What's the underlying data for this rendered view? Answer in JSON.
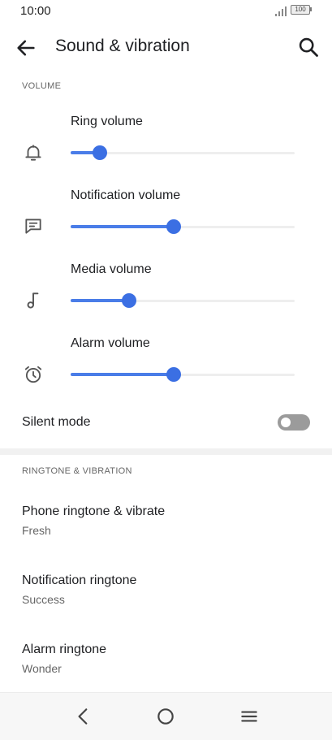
{
  "status_bar": {
    "time": "10:00",
    "battery": "100"
  },
  "app_bar": {
    "title": "Sound & vibration",
    "back_icon": "arrow-left-icon",
    "search_icon": "search-icon"
  },
  "volume_section": {
    "header": "VOLUME",
    "sliders": [
      {
        "label": "Ring volume",
        "icon": "bell-icon",
        "level": 0.13
      },
      {
        "label": "Notification volume",
        "icon": "message-icon",
        "level": 0.46
      },
      {
        "label": "Media volume",
        "icon": "music-note-icon",
        "level": 0.26
      },
      {
        "label": "Alarm volume",
        "icon": "alarm-clock-icon",
        "level": 0.46
      }
    ]
  },
  "silent_mode": {
    "label": "Silent mode",
    "enabled": false
  },
  "ringtone_section": {
    "header": "RINGTONE & VIBRATION",
    "items": [
      {
        "title": "Phone ringtone & vibrate",
        "summary": "Fresh"
      },
      {
        "title": "Notification ringtone",
        "summary": "Success"
      },
      {
        "title": "Alarm ringtone",
        "summary": "Wonder"
      }
    ]
  },
  "nav_bar": {
    "back_icon": "nav-back-icon",
    "home_icon": "nav-home-icon",
    "menu_icon": "nav-menu-icon"
  },
  "colors": {
    "accent": "#3b6fe3",
    "track": "#eeeeee",
    "toggle_off": "#9b9b9b"
  }
}
